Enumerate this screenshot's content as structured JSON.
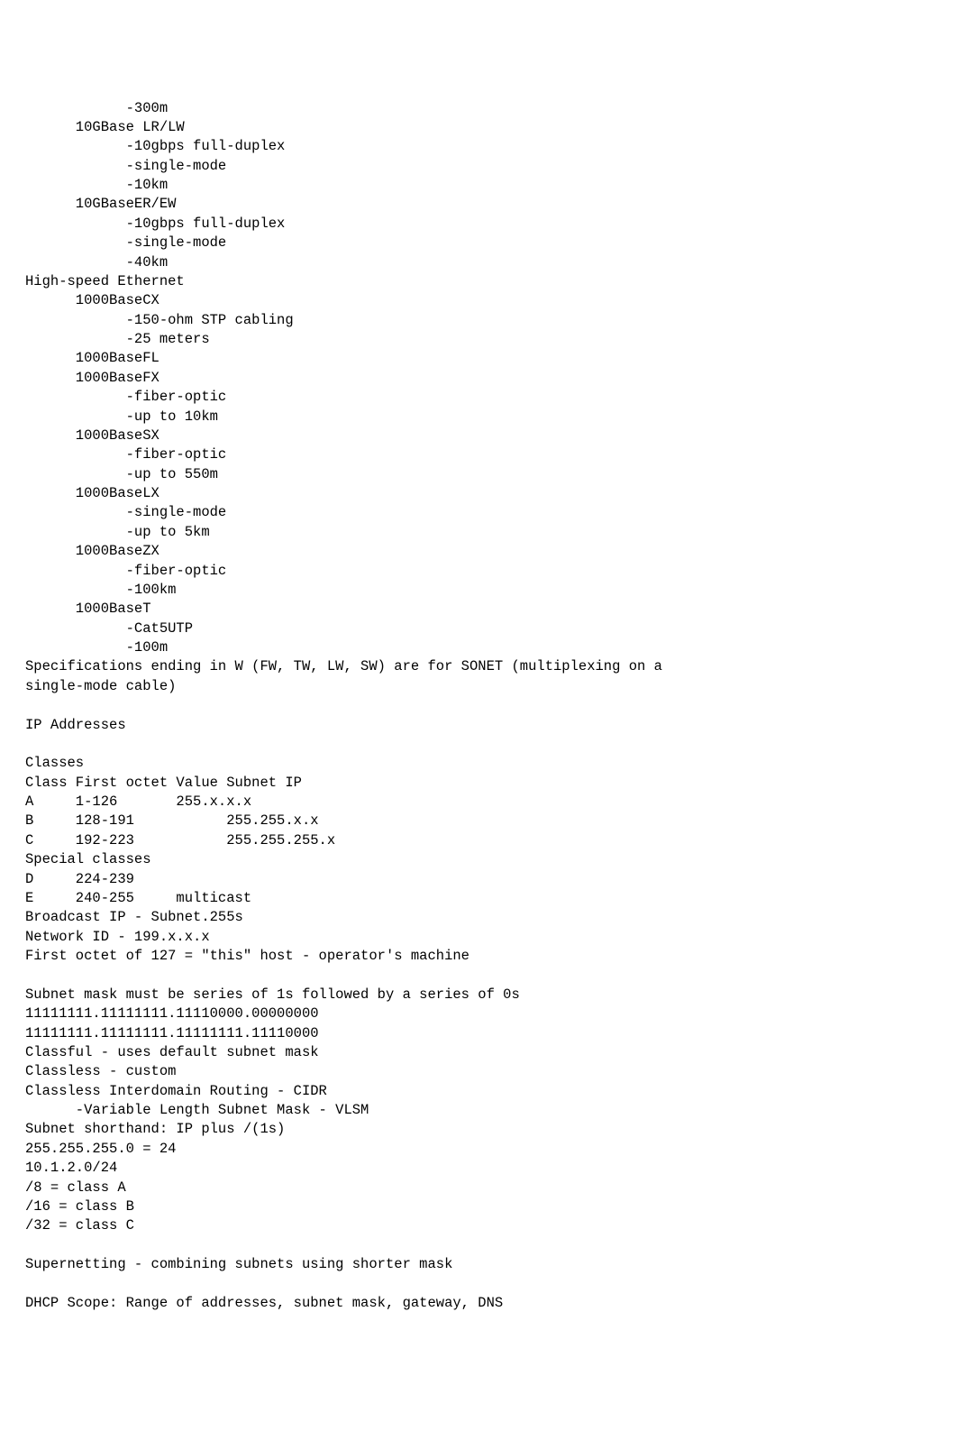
{
  "lines": [
    "            -300m",
    "      10GBase LR/LW",
    "            -10gbps full-duplex",
    "            -single-mode",
    "            -10km",
    "      10GBaseER/EW",
    "            -10gbps full-duplex",
    "            -single-mode",
    "            -40km",
    "High-speed Ethernet",
    "      1000BaseCX",
    "            -150-ohm STP cabling",
    "            -25 meters",
    "      1000BaseFL",
    "      1000BaseFX",
    "            -fiber-optic",
    "            -up to 10km",
    "      1000BaseSX",
    "            -fiber-optic",
    "            -up to 550m",
    "      1000BaseLX",
    "            -single-mode",
    "            -up to 5km",
    "      1000BaseZX",
    "            -fiber-optic",
    "            -100km",
    "      1000BaseT",
    "            -Cat5UTP",
    "            -100m",
    "Specifications ending in W (FW, TW, LW, SW) are for SONET (multiplexing on a",
    "single-mode cable)",
    "",
    "IP Addresses",
    "",
    "Classes",
    "Class First octet Value Subnet IP",
    "A     1-126       255.x.x.x",
    "B     128-191           255.255.x.x",
    "C     192-223           255.255.255.x",
    "Special classes",
    "D     224-239",
    "E     240-255     multicast",
    "Broadcast IP - Subnet.255s",
    "Network ID - 199.x.x.x",
    "First octet of 127 = \"this\" host - operator's machine",
    "",
    "Subnet mask must be series of 1s followed by a series of 0s",
    "11111111.11111111.11110000.00000000",
    "11111111.11111111.11111111.11110000",
    "Classful - uses default subnet mask",
    "Classless - custom",
    "Classless Interdomain Routing - CIDR",
    "      -Variable Length Subnet Mask - VLSM",
    "Subnet shorthand: IP plus /(1s)",
    "255.255.255.0 = 24",
    "10.1.2.0/24",
    "/8 = class A",
    "/16 = class B",
    "/32 = class C",
    "",
    "Supernetting - combining subnets using shorter mask",
    "",
    "DHCP Scope: Range of addresses, subnet mask, gateway, DNS"
  ]
}
